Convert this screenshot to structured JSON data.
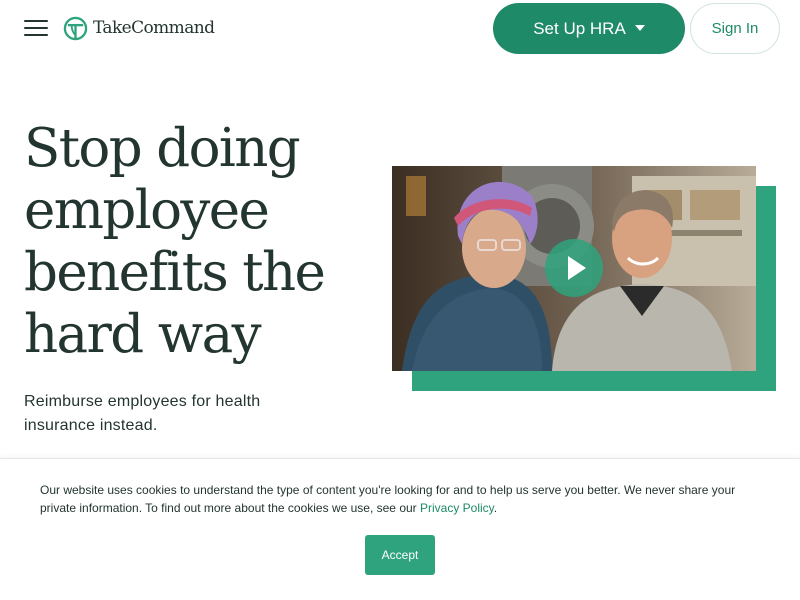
{
  "header": {
    "menu_icon": "hamburger-menu-icon",
    "logo_icon": "take-command-logo-icon",
    "logo_text": "TakeCommand",
    "setup_button_label": "Set Up HRA",
    "setup_button_icon": "caret-down-icon",
    "signin_button_label": "Sign In"
  },
  "hero": {
    "title": "Stop doing employee benefits the hard way",
    "subtitle": "Reimburse employees for health insurance instead.",
    "video_play_icon": "play-icon"
  },
  "cookie_banner": {
    "text": "Our website uses cookies to understand the type of content you're looking for and to help us serve you better. We never share your private information. To find out more about the cookies we use, see our ",
    "link_label": "Privacy Policy",
    "text_end": ".",
    "accept_label": "Accept"
  },
  "colors": {
    "brand_green": "#1f8a68",
    "accent_green": "#2ea37d",
    "text_dark": "#233531"
  }
}
